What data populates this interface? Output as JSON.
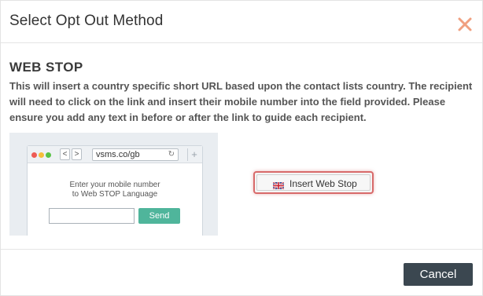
{
  "header": {
    "title": "Select Opt Out Method",
    "close_icon": "close-icon"
  },
  "section": {
    "title": "WEB STOP",
    "description": "This will insert a country specific short URL based upon the contact lists country. The recipient will need to click on the link and insert their mobile number into the field provided. Please ensure you add any text in before or after the link to guide each recipient."
  },
  "preview": {
    "url": "vsms.co/gb",
    "back": "<",
    "forward": ">",
    "reload": "↻",
    "new_tab": "+",
    "prompt_line1": "Enter your mobile number",
    "prompt_line2": "to Web STOP Language",
    "input_value": "",
    "send_label": "Send"
  },
  "insert_button": {
    "label": "Insert Web Stop",
    "icon": "uk-flag-icon"
  },
  "footer": {
    "cancel_label": "Cancel"
  },
  "colors": {
    "accent_green": "#4fb59b",
    "close_orange": "#f0a080",
    "cancel_bg": "#3b4750",
    "highlight_red": "#d86a6a"
  }
}
